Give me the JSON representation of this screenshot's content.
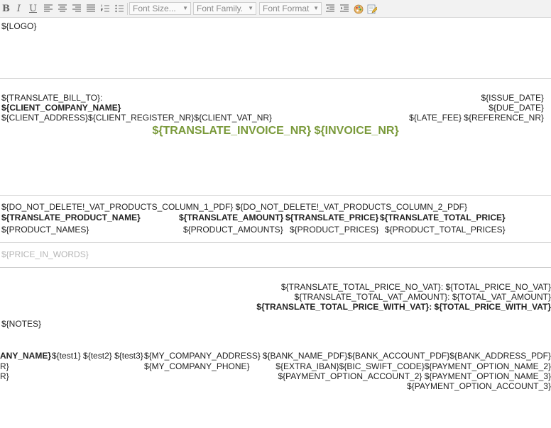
{
  "toolbar": {
    "bold": "B",
    "italic": "I",
    "underline": "U",
    "font_size_placeholder": "Font Size...",
    "font_family_placeholder": "Font Family.",
    "font_format_placeholder": "Font Format"
  },
  "document": {
    "logo": "${LOGO}",
    "bill_to": "${TRANSLATE_BILL_TO}:",
    "client_company": "${CLIENT_COMPANY_NAME}",
    "client_address_line": "${CLIENT_ADDRESS}${CLIENT_REGISTER_NR}${CLIENT_VAT_NR}",
    "issue_date": "${ISSUE_DATE}",
    "due_date": "${DUE_DATE}",
    "late_fee_ref": "${LATE_FEE} ${REFERENCE_NR}",
    "invoice_title": "${TRANSLATE_INVOICE_NR} ${INVOICE_NR}",
    "vat_columns": "${DO_NOT_DELETE!_VAT_PRODUCTS_COLUMN_1_PDF} ${DO_NOT_DELETE!_VAT_PRODUCTS_COLUMN_2_PDF}",
    "table": {
      "headers": [
        "${TRANSLATE_PRODUCT_NAME}",
        "${TRANSLATE_AMOUNT}",
        "${TRANSLATE_PRICE}",
        "${TRANSLATE_TOTAL_PRICE}"
      ],
      "values": [
        "${PRODUCT_NAMES}",
        "${PRODUCT_AMOUNTS}",
        "${PRODUCT_PRICES}",
        "${PRODUCT_TOTAL_PRICES}"
      ]
    },
    "price_in_words": "${PRICE_IN_WORDS}",
    "totals": {
      "no_vat": "${TRANSLATE_TOTAL_PRICE_NO_VAT}: ${TOTAL_PRICE_NO_VAT}",
      "vat_amount": "${TRANSLATE_TOTAL_VAT_AMOUNT}: ${TOTAL_VAT_AMOUNT}",
      "with_vat": "${TRANSLATE_TOTAL_PRICE_WITH_VAT}: ${TOTAL_PRICE_WITH_VAT}"
    },
    "notes": "${NOTES}",
    "footer": {
      "company_name_clipped": "ANY_NAME}",
      "tests": "${test1} ${test2} ${test3}",
      "col1_row2": "R}",
      "col1_row3": "R}",
      "my_company_address": "${MY_COMPANY_ADDRESS}",
      "my_company_phone": "${MY_COMPANY_PHONE}",
      "bank_line": "${BANK_NAME_PDF}${BANK_ACCOUNT_PDF}${BANK_ADDRESS_PDF}",
      "iban_line": "${EXTRA_IBAN}${BIC_SWIFT_CODE}${PAYMENT_OPTION_NAME_2}",
      "payment_account_2_line": "${PAYMENT_OPTION_ACCOUNT_2} ${PAYMENT_OPTION_NAME_3}",
      "payment_account_3": "${PAYMENT_OPTION_ACCOUNT_3}"
    }
  },
  "colors": {
    "accent_green": "#7a9a3b",
    "muted_gray": "#b5b5b5"
  }
}
